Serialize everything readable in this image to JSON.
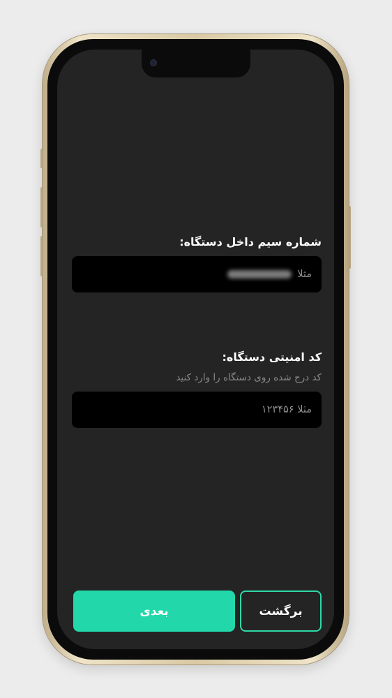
{
  "screen": {
    "sim_field": {
      "label": "شماره سیم داخل دستگاه:",
      "placeholder_prefix": "مثلا"
    },
    "security_field": {
      "label": "کد امنیتی دستگاه:",
      "hint": "کد درج شده روی دستگاه را وارد کنید",
      "placeholder": "مثلا ۱۲۳۴۵۶"
    },
    "buttons": {
      "back_label": "برگشت",
      "next_label": "بعدی"
    }
  },
  "colors": {
    "accent": "#22d8aa",
    "screen_bg": "#242424",
    "input_bg": "#000000",
    "page_bg": "#ececec"
  }
}
